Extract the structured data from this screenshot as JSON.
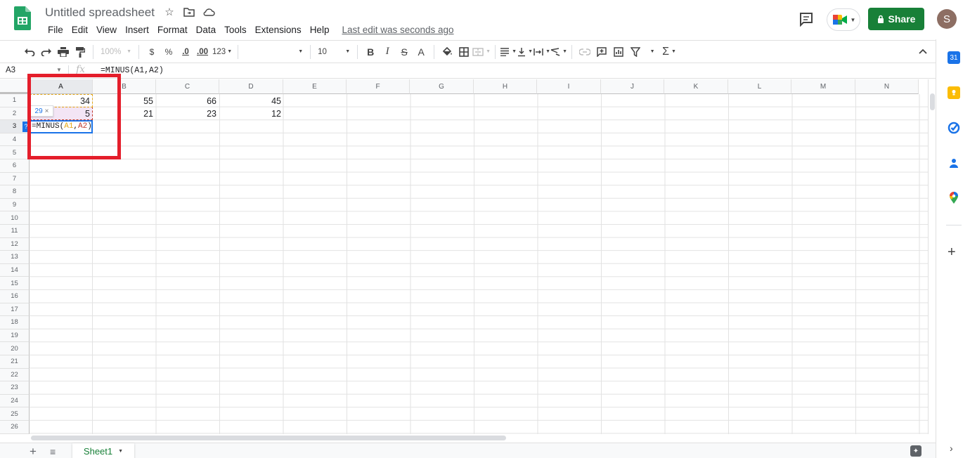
{
  "header": {
    "title": "Untitled spreadsheet",
    "menu": [
      "File",
      "Edit",
      "View",
      "Insert",
      "Format",
      "Data",
      "Tools",
      "Extensions",
      "Help"
    ],
    "last_edit": "Last edit was seconds ago",
    "share_label": "Share",
    "avatar_letter": "S"
  },
  "toolbar": {
    "zoom": "100%",
    "currency": "$",
    "percent": "%",
    "dec_less": ".0",
    "dec_more": ".00",
    "format_more": "123",
    "font_size": "10",
    "bold": "B",
    "italic": "I",
    "strike": "S",
    "text_color": "A",
    "sum": "Σ"
  },
  "formula_bar": {
    "name_box": "A3",
    "fx": "fx",
    "formula": "=MINUS(A1,A2)"
  },
  "columns": [
    "A",
    "B",
    "C",
    "D",
    "E",
    "F",
    "G",
    "H",
    "I",
    "J",
    "K",
    "L",
    "M",
    "N"
  ],
  "rows": [
    "1",
    "2",
    "3",
    "4",
    "5",
    "6",
    "7",
    "8",
    "9",
    "10",
    "11",
    "12",
    "13",
    "14",
    "15",
    "16",
    "17",
    "18",
    "19",
    "20",
    "21",
    "22",
    "23",
    "24",
    "25",
    "26"
  ],
  "cells": {
    "A1": "34",
    "B1": "55",
    "C1": "66",
    "D1": "45",
    "A2": "5",
    "B2": "21",
    "C2": "23",
    "D2": "12"
  },
  "editor": {
    "prefix": "=MINUS(",
    "ref1": "A1",
    "comma": ",",
    "ref2": "A2",
    "suffix": ")",
    "preview_value": "29",
    "preview_close": "×",
    "cell_tag": "?"
  },
  "sheets": [
    "Sheet1"
  ],
  "colors": {
    "brand_green": "#188038",
    "selection_blue": "#1a73e8",
    "ref1_color": "#e6a817",
    "ref2_color": "#c0392b",
    "highlight_red": "#e41e2b"
  }
}
